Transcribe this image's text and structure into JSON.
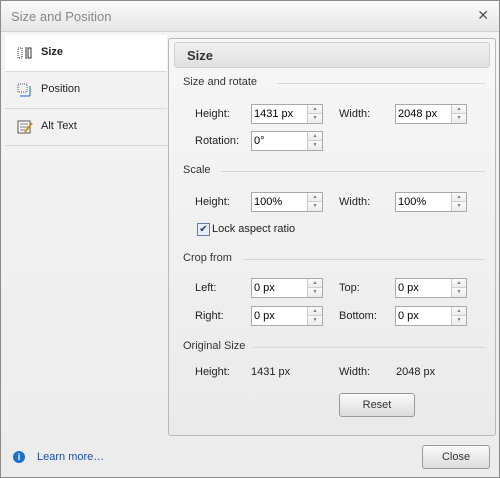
{
  "window": {
    "title": "Size and Position",
    "close_glyph": "✕"
  },
  "nav": {
    "items": [
      {
        "label": "Size",
        "icon": "size-icon"
      },
      {
        "label": "Position",
        "icon": "position-icon"
      },
      {
        "label": "Alt Text",
        "icon": "alt-text-icon"
      }
    ]
  },
  "panel": {
    "title": "Size",
    "size_rotate": {
      "heading": "Size and rotate",
      "height_label": "Height:",
      "height_value": "1431 px",
      "width_label": "Width:",
      "width_value": "2048 px",
      "rotation_label": "Rotation:",
      "rotation_value": "0°"
    },
    "scale": {
      "heading": "Scale",
      "height_label": "Height:",
      "height_value": "100%",
      "width_label": "Width:",
      "width_value": "100%",
      "lock_label": "Lock aspect ratio",
      "lock_checked": true
    },
    "crop": {
      "heading": "Crop from",
      "left_label": "Left:",
      "left_value": "0 px",
      "top_label": "Top:",
      "top_value": "0 px",
      "right_label": "Right:",
      "right_value": "0 px",
      "bottom_label": "Bottom:",
      "bottom_value": "0 px"
    },
    "original": {
      "heading": "Original Size",
      "height_label": "Height:",
      "height_value": "1431 px",
      "width_label": "Width:",
      "width_value": "2048 px"
    },
    "reset_label": "Reset"
  },
  "footer": {
    "learn_more": "Learn more…",
    "info_glyph": "i",
    "close_label": "Close"
  }
}
